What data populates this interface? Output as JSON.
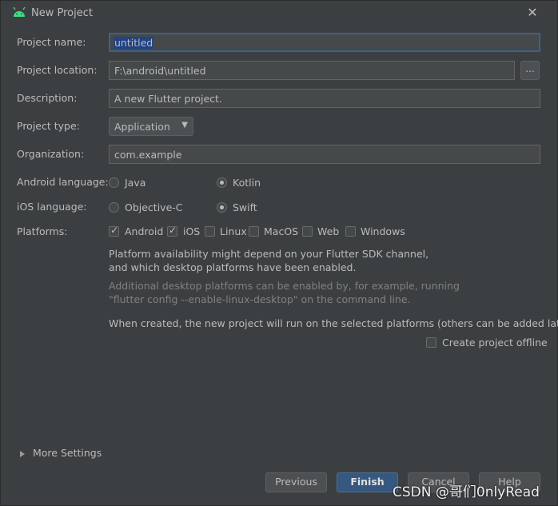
{
  "dialog": {
    "title": "New Project",
    "close_glyph": "✕"
  },
  "form": {
    "project_name": {
      "label": "Project name:",
      "value": "untitled"
    },
    "project_location": {
      "label": "Project location:",
      "value": "F:\\android\\untitled",
      "browse_label": "..."
    },
    "description": {
      "label": "Description:",
      "value": "A new Flutter project."
    },
    "project_type": {
      "label": "Project type:",
      "value": "Application"
    },
    "organization": {
      "label": "Organization:",
      "value": "com.example"
    },
    "android_language": {
      "label": "Android language:",
      "options": [
        "Java",
        "Kotlin"
      ],
      "selected": "Kotlin"
    },
    "ios_language": {
      "label": "iOS language:",
      "options": [
        "Objective-C",
        "Swift"
      ],
      "selected": "Swift"
    },
    "platforms": {
      "label": "Platforms:",
      "items": [
        {
          "label": "Android",
          "checked": true
        },
        {
          "label": "iOS",
          "checked": true
        },
        {
          "label": "Linux",
          "checked": false
        },
        {
          "label": "MacOS",
          "checked": false
        },
        {
          "label": "Web",
          "checked": false
        },
        {
          "label": "Windows",
          "checked": false
        }
      ]
    }
  },
  "notes": {
    "line1": "Platform availability might depend on your Flutter SDK channel,",
    "line2": "and which desktop platforms have been enabled.",
    "line3": "Additional desktop platforms can be enabled by, for example, running",
    "line4": "\"flutter config --enable-linux-desktop\" on the command line.",
    "line5": "When created, the new project will run on the selected platforms (others can be added later)."
  },
  "offline": {
    "label": "Create project offline",
    "checked": false
  },
  "more_settings": "More Settings",
  "buttons": {
    "previous": "Previous",
    "finish": "Finish",
    "cancel": "Cancel",
    "help": "Help"
  },
  "watermark": "CSDN @哥们0nlyRead",
  "colors": {
    "background": "#3c3f41",
    "field": "#45494a",
    "primary_button": "#365880",
    "selection": "#214283"
  },
  "icons": {
    "title": "android-icon",
    "close": "close-icon",
    "more": "triangle-right-icon",
    "combo": "chevron-down-icon"
  }
}
